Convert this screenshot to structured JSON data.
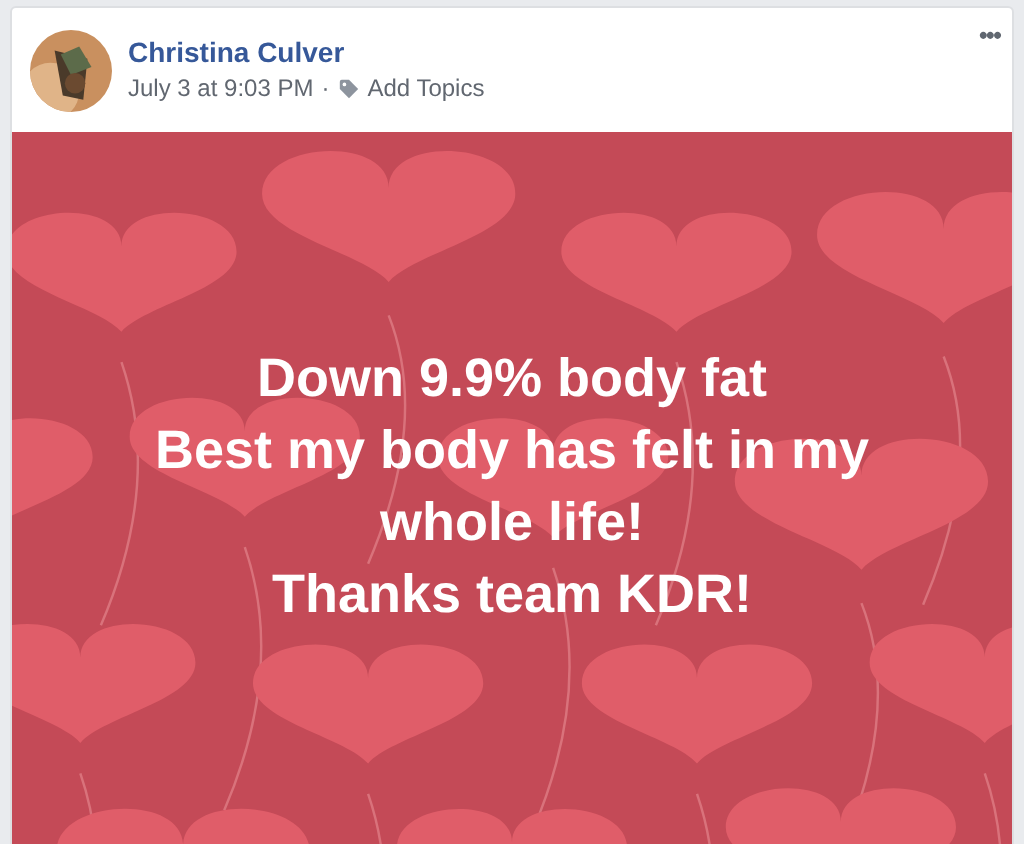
{
  "post": {
    "author": "Christina Culver",
    "timestamp": "July 3 at 9:03 PM",
    "separator": "·",
    "topics_link": "Add Topics",
    "menu": "•••",
    "text_lines": [
      "Down 9.9% body fat",
      "Best my body has felt in my",
      "whole life!",
      "Thanks team KDR!"
    ]
  }
}
